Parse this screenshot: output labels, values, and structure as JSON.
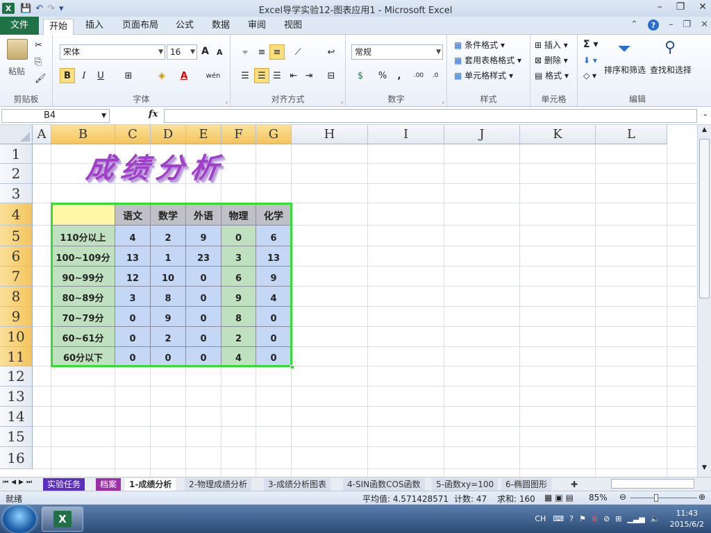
{
  "window": {
    "title": "Excel导学实验12-图表应用1 - Microsoft Excel",
    "minimize": "–",
    "maximize": "❐",
    "close": "✕"
  },
  "app_icon": "X",
  "qat": {
    "save": "💾",
    "undo": "↶",
    "redo": "↷",
    "customize": "▾"
  },
  "tabs": {
    "file": "文件",
    "items": [
      "开始",
      "插入",
      "页面布局",
      "公式",
      "数据",
      "审阅",
      "视图"
    ]
  },
  "ribbon": {
    "clipboard": {
      "label": "剪贴板",
      "paste": "粘贴"
    },
    "font": {
      "label": "字体",
      "name": "宋体",
      "size": "16",
      "bold": "B",
      "italic": "I",
      "underline": "U",
      "grow": "A",
      "shrink": "A",
      "color_a": "A",
      "wen": "wén"
    },
    "alignment": {
      "label": "对齐方式"
    },
    "number": {
      "label": "数字",
      "format": "常规",
      "percent": "%",
      "comma": ","
    },
    "styles": {
      "label": "样式",
      "cond": "条件格式",
      "table": "套用表格格式",
      "cell": "单元格样式"
    },
    "cells": {
      "label": "单元格",
      "insert": "插入",
      "delete": "删除",
      "format": "格式"
    },
    "editing": {
      "label": "编辑",
      "sum": "Σ",
      "sort": "排序和筛选",
      "find": "查找和选择"
    }
  },
  "formula_bar": {
    "name_box": "B4",
    "fx": "fx",
    "value": ""
  },
  "columns": [
    {
      "label": "A",
      "sel": false
    },
    {
      "label": "B",
      "sel": true
    },
    {
      "label": "C",
      "sel": true
    },
    {
      "label": "D",
      "sel": true
    },
    {
      "label": "E",
      "sel": true
    },
    {
      "label": "F",
      "sel": true
    },
    {
      "label": "G",
      "sel": true
    },
    {
      "label": "H",
      "sel": false
    },
    {
      "label": "I",
      "sel": false
    },
    {
      "label": "J",
      "sel": false
    },
    {
      "label": "K",
      "sel": false
    },
    {
      "label": "L",
      "sel": false
    }
  ],
  "rows": [
    {
      "label": "1",
      "sel": false
    },
    {
      "label": "2",
      "sel": false
    },
    {
      "label": "3",
      "sel": false
    },
    {
      "label": "4",
      "sel": true
    },
    {
      "label": "5",
      "sel": true
    },
    {
      "label": "6",
      "sel": true
    },
    {
      "label": "7",
      "sel": true
    },
    {
      "label": "8",
      "sel": true
    },
    {
      "label": "9",
      "sel": true
    },
    {
      "label": "10",
      "sel": true
    },
    {
      "label": "11",
      "sel": true
    },
    {
      "label": "12",
      "sel": false
    },
    {
      "label": "13",
      "sel": false
    },
    {
      "label": "14",
      "sel": false
    },
    {
      "label": "15",
      "sel": false
    },
    {
      "label": "16",
      "sel": false
    }
  ],
  "wordart": "成绩分析",
  "table": {
    "headers": [
      "",
      "语文",
      "数学",
      "外语",
      "物理",
      "化学"
    ],
    "rows": [
      [
        "110分以上",
        "4",
        "2",
        "9",
        "0",
        "6"
      ],
      [
        "100~109分",
        "13",
        "1",
        "23",
        "3",
        "13"
      ],
      [
        "90~99分",
        "12",
        "10",
        "0",
        "6",
        "9"
      ],
      [
        "80~89分",
        "3",
        "8",
        "0",
        "9",
        "4"
      ],
      [
        "70~79分",
        "0",
        "9",
        "0",
        "8",
        "0"
      ],
      [
        "60~61分",
        "0",
        "2",
        "0",
        "2",
        "0"
      ],
      [
        "60分以下",
        "0",
        "0",
        "0",
        "4",
        "0"
      ]
    ]
  },
  "sheet_tabs": [
    "实验任务",
    "档案",
    "1-成绩分析",
    "2-物理成绩分析",
    "3-成绩分析图表",
    "4-SIN函数COS函数",
    "5-函数xy=100",
    "6-椭圆图形"
  ],
  "active_sheet": "1-成绩分析",
  "status": {
    "ready": "就绪",
    "average": "平均值: 4.571428571",
    "count": "计数: 47",
    "sum": "求和: 160",
    "zoom": "85%"
  },
  "taskbar": {
    "lang": "CH",
    "time": "11:43",
    "date": "2015/6/2"
  },
  "colors": {
    "selection": "#33dd33",
    "excel_green": "#1f7246",
    "header_gray": "#c0c0c8",
    "label_green": "#bfe1bf",
    "value_blue": "#c4d8f5",
    "blank_yellow": "#fff8a8"
  }
}
